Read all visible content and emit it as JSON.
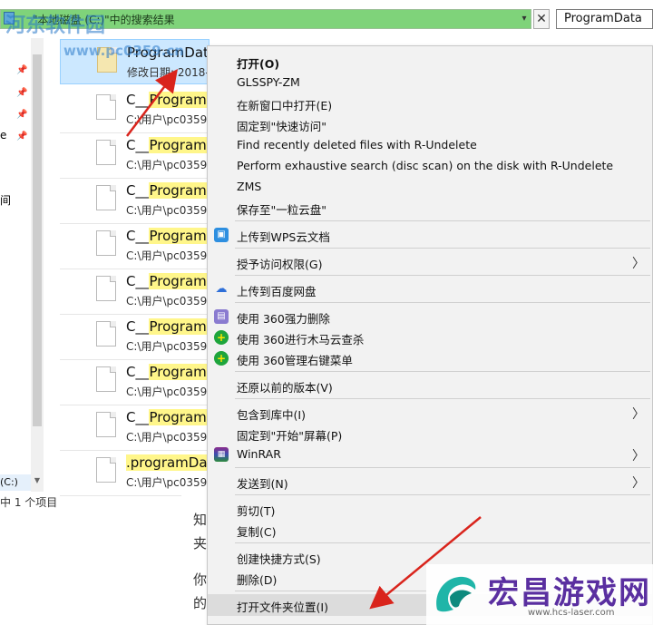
{
  "address_bar": {
    "path": "\"本地磁盘 (C:)\"中的搜索结果",
    "search_value": "ProgramData",
    "clear_symbol": "✕",
    "dropdown_symbol": "▾"
  },
  "nav": {
    "drive_label": "(C:)",
    "status": "中 1 个项目",
    "fragment_e": "e",
    "fragment_jian": "间"
  },
  "results": [
    {
      "title_pre": "",
      "title_hl": "",
      "title_post": "ProgramDat",
      "sub": "修改日期: 2018-",
      "selected": true
    },
    {
      "title_pre": "C__",
      "title_hl": "Program",
      "title_post": "",
      "sub": "C:\\用户\\pc0359"
    },
    {
      "title_pre": "C__",
      "title_hl": "Program",
      "title_post": "",
      "sub": "C:\\用户\\pc0359"
    },
    {
      "title_pre": "C__",
      "title_hl": "Program",
      "title_post": "",
      "sub": "C:\\用户\\pc0359"
    },
    {
      "title_pre": "C__",
      "title_hl": "Program",
      "title_post": "",
      "sub": "C:\\用户\\pc0359"
    },
    {
      "title_pre": "C__",
      "title_hl": "Program",
      "title_post": "",
      "sub": "C:\\用户\\pc0359"
    },
    {
      "title_pre": "C__",
      "title_hl": "Program",
      "title_post": "",
      "sub": "C:\\用户\\pc0359"
    },
    {
      "title_pre": "C__",
      "title_hl": "Program",
      "title_post": "",
      "sub": "C:\\用户\\pc0359"
    },
    {
      "title_pre": "C__",
      "title_hl": "Program",
      "title_post": "",
      "sub": "C:\\用户\\pc0359"
    },
    {
      "title_pre": "",
      "title_hl": ".programDa",
      "title_post": "",
      "sub": "C:\\用户\\pc0359"
    }
  ],
  "menu": {
    "open": "打开(O)",
    "glsspy": "GLSSPY-ZM",
    "open_new_window": "在新窗口中打开(E)",
    "pin_quick": "固定到\"快速访问\"",
    "r_undelete_find": "Find recently deleted files with R-Undelete",
    "r_undelete_scan": "Perform exhaustive search (disc scan) on the disk with R-Undelete",
    "zms": "ZMS",
    "save_yili": "保存至\"一粒云盘\"",
    "wps_upload": "上传到WPS云文档",
    "grant_access": "授予访问权限(G)",
    "baidu_upload": "上传到百度网盘",
    "del_360": "使用 360强力删除",
    "scan_360": "使用 360进行木马云查杀",
    "manage_360": "使用 360管理右键菜单",
    "restore_prev": "还原以前的版本(V)",
    "include_lib": "包含到库中(I)",
    "pin_start": "固定到\"开始\"屏幕(P)",
    "winrar": "WinRAR",
    "send_to": "发送到(N)",
    "cut": "剪切(T)",
    "copy": "复制(C)",
    "create_shortcut": "创建快捷方式(S)",
    "delete": "删除(D)",
    "open_location": "打开文件夹位置(I)",
    "submenu_arrow": "〉"
  },
  "background_text": {
    "line1": "知",
    "line2": "夹",
    "line3": "你",
    "line4": "的"
  },
  "watermarks": {
    "top_site": "河东软件园",
    "top_url": "www.pc0359.cn",
    "brand": "宏昌游戏网",
    "brand_url": "www.hcs-laser.com"
  },
  "colors": {
    "address_bar_green": "#7fd37a",
    "selection_blue": "#cce8ff",
    "highlight_yellow": "#fff68a",
    "menu_bg": "#f2f2f2",
    "arrow_red": "#d9241c",
    "brand_purple": "#5a2fa0"
  }
}
